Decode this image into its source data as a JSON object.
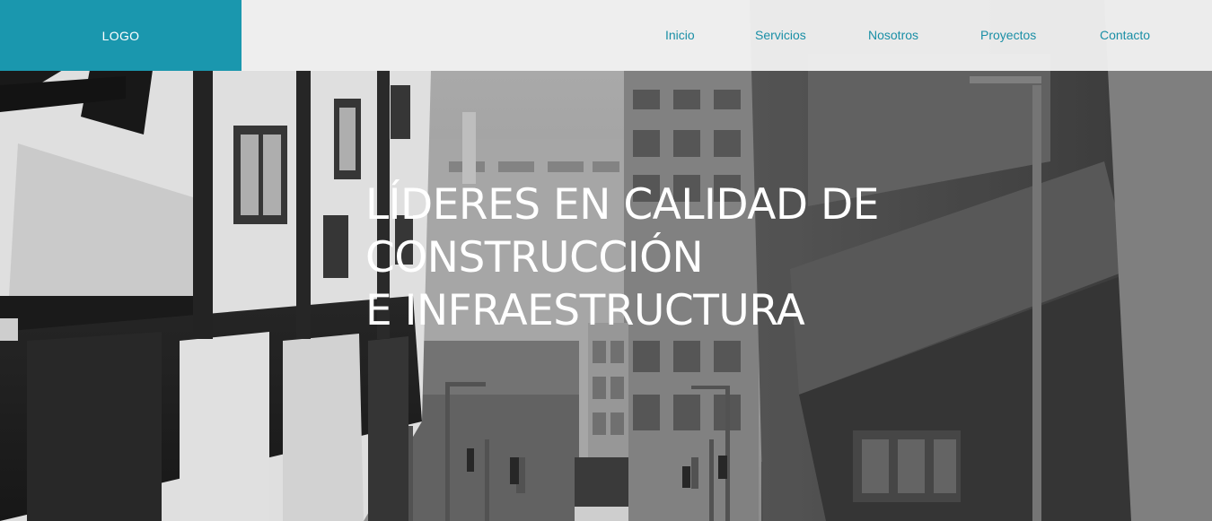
{
  "header": {
    "logo_text": "LOGO",
    "accent_color": "#1a97ae",
    "nav_text_color": "#1a8fa6",
    "nav": [
      {
        "label": "Inicio"
      },
      {
        "label": "Servicios"
      },
      {
        "label": "Nosotros"
      },
      {
        "label": "Proyectos"
      },
      {
        "label": "Contacto"
      }
    ]
  },
  "hero": {
    "title_lines": [
      "LÍDERES EN CALIDAD DE",
      "CONSTRUCCIÓN",
      "E INFRAESTRUCTURA"
    ],
    "background": "grayscale city street with buildings"
  }
}
